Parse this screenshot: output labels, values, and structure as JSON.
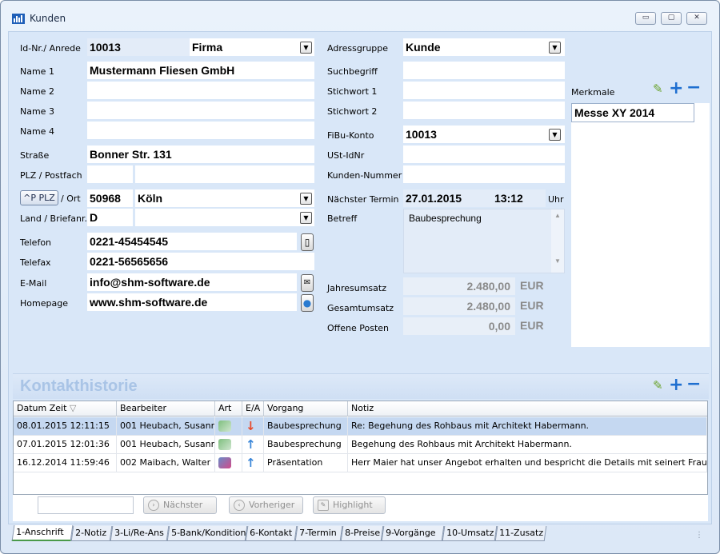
{
  "window": {
    "title": "Kunden",
    "controls": {
      "minimize": "▭",
      "maximize": "▢",
      "close": "✕"
    }
  },
  "labels": {
    "id_anrede": "Id-Nr./ Anrede",
    "name1": "Name 1",
    "name2": "Name 2",
    "name3": "Name 3",
    "name4": "Name 4",
    "strasse": "Straße",
    "plz_postfach": "PLZ / Postfach",
    "plz_button": "^P PLZ",
    "ort": "/ Ort",
    "land": "Land / Briefanr.",
    "telefon": "Telefon",
    "telefax": "Telefax",
    "email": "E-Mail",
    "homepage": "Homepage",
    "adressgruppe": "Adressgruppe",
    "suchbegriff": "Suchbegriff",
    "stichwort1": "Stichwort 1",
    "stichwort2": "Stichwort 2",
    "fibu": "FiBu-Konto",
    "ustid": "USt-IdNr",
    "kundennr": "Kunden-Nummer",
    "naechster_termin": "Nächster Termin",
    "uhr": "Uhr",
    "betreff": "Betreff",
    "jahresumsatz": "Jahresumsatz",
    "gesamtumsatz": "Gesamtumsatz",
    "offene_posten": "Offene Posten",
    "merkmale": "Merkmale"
  },
  "values": {
    "id": "10013",
    "anrede": "Firma",
    "name1": "Mustermann Fliesen GmbH",
    "name2": "",
    "name3": "",
    "name4": "",
    "strasse": "Bonner Str. 131",
    "plz": "",
    "postfach": "",
    "ort_plz": "50968",
    "ort": "Köln",
    "land": "D",
    "briefanrede": "",
    "telefon": "0221-45454545",
    "telefax": "0221-56565656",
    "email": "info@shm-software.de",
    "homepage": "www.shm-software.de",
    "adressgruppe": "Kunde",
    "suchbegriff": "",
    "stichwort1": "",
    "stichwort2": "",
    "fibu": "10013",
    "ustid": "",
    "kundennr": "",
    "termin_datum": "27.01.2015",
    "termin_zeit": "13:12",
    "betreff": "Baubesprechung",
    "jahresumsatz": "2.480,00",
    "gesamtumsatz": "2.480,00",
    "offene_posten": "0,00",
    "currency": "EUR"
  },
  "merkmale": {
    "items": [
      "Messe XY 2014"
    ]
  },
  "kontakthistorie": {
    "title": "Kontakthistorie",
    "columns": [
      "Datum Zeit",
      "Bearbeiter",
      "Art",
      "E/A",
      "Vorgang",
      "Notiz"
    ],
    "rows": [
      {
        "datum": "08.01.2015 12:11:15",
        "bearbeiter": "001 Heubach, Susann",
        "art": "phone-contact-icon",
        "ea": "↓",
        "ea_color": "#e84a2a",
        "vorgang": "Baubesprechung",
        "notiz": "Re: Begehung des Rohbaus mit Architekt Habermann."
      },
      {
        "datum": "07.01.2015 12:01:36",
        "bearbeiter": "001 Heubach, Susann",
        "art": "phone-contact-icon",
        "ea": "↑",
        "ea_color": "#3a86d8",
        "vorgang": "Baubesprechung",
        "notiz": "Begehung des Rohbaus mit Architekt Habermann."
      },
      {
        "datum": "16.12.2014 11:59:46",
        "bearbeiter": "002 Maibach, Walter",
        "art": "presentation-icon",
        "ea": "↑",
        "ea_color": "#3a86d8",
        "vorgang": "Präsentation",
        "notiz": "Herr Maier hat unser Angebot erhalten und bespricht die Details mit seinert Frau."
      }
    ],
    "buttons": {
      "next": "Nächster",
      "prev": "Vorheriger",
      "highlight": "Highlight"
    }
  },
  "tabs": [
    "1-Anschrift",
    "2-Notiz",
    "3-Li/Re-Ans",
    "5-Bank/Kondition",
    "6-Kontakt",
    "7-Termin",
    "8-Preise",
    "9-Vorgänge",
    "10-Umsatz",
    "11-Zusatz"
  ],
  "colors": {
    "accent": "#1f6fd0",
    "selected_row": "#c5d8f1",
    "client_bg": "#d9e7f8"
  }
}
